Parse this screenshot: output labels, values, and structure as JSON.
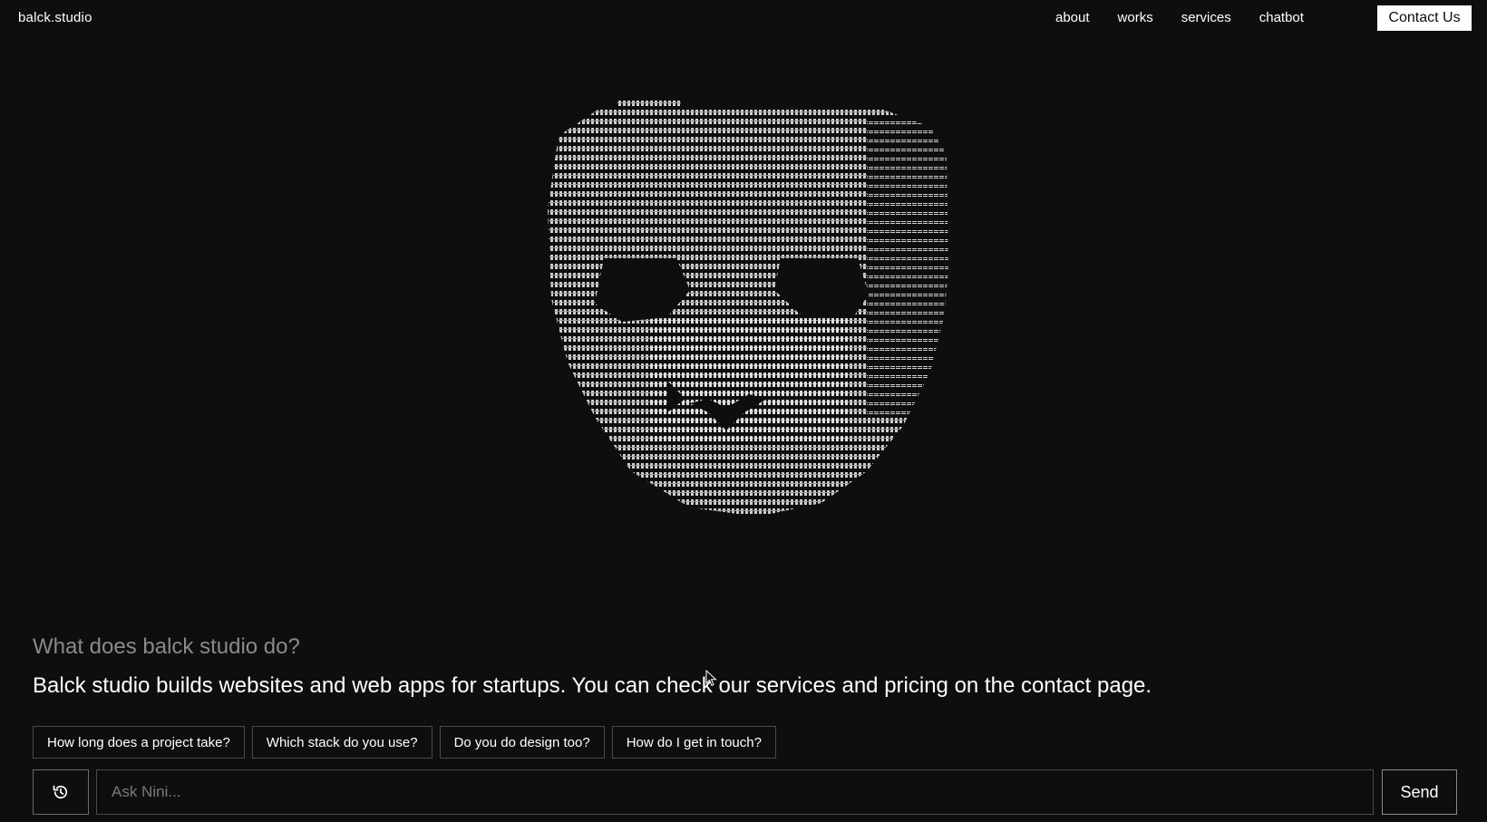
{
  "header": {
    "logo": "balck.studio",
    "nav": [
      {
        "label": "about"
      },
      {
        "label": "works"
      },
      {
        "label": "services"
      },
      {
        "label": "chatbot"
      }
    ],
    "contact_label": "Contact Us"
  },
  "hero": {
    "art_icon": "ascii-mask-face",
    "art_color": "#d8d8d8"
  },
  "chat": {
    "question": "What does balck studio do?",
    "answer": "Balck studio builds websites and web apps for startups. You can check our services and pricing on the contact page.",
    "suggestions": [
      {
        "label": "How long does a project take?"
      },
      {
        "label": "Which stack do you use?"
      },
      {
        "label": "Do you do design too?"
      },
      {
        "label": "How do I get in touch?"
      }
    ],
    "history_icon": "history-icon",
    "input_placeholder": "Ask Nini...",
    "send_label": "Send"
  },
  "colors": {
    "background": "#0e0e0e",
    "text": "#ffffff",
    "muted": "#8a8a8a",
    "border": "#4a4a4a"
  }
}
